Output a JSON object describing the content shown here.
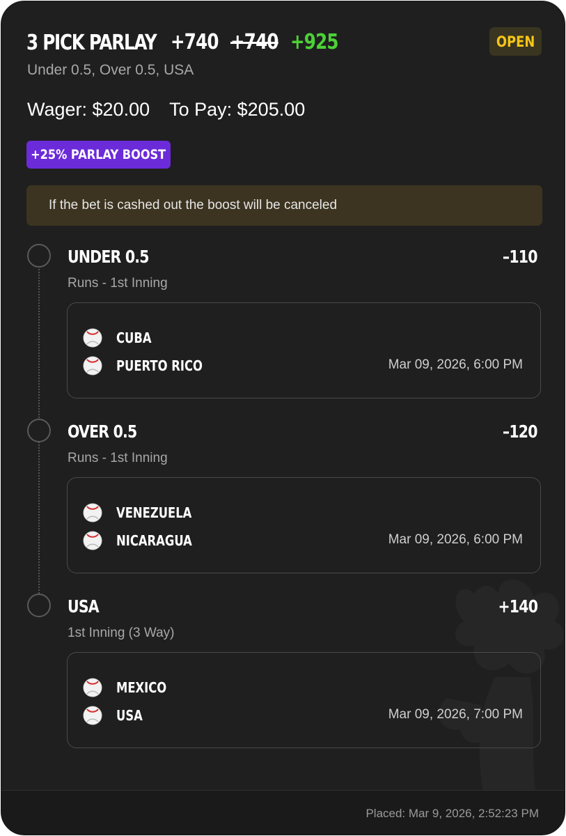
{
  "header": {
    "title": "3 PICK PARLAY",
    "odds_original": "+740",
    "odds_struck": "+740",
    "odds_boosted": "+925",
    "status": "OPEN",
    "subtitle": "Under 0.5, Over 0.5, USA"
  },
  "wager": {
    "wager_text": "Wager: $20.00",
    "to_pay_text": "To Pay: $205.00"
  },
  "boost": {
    "label": "+25% PARLAY BOOST",
    "notice": "If the bet is cashed out the boost will be canceled"
  },
  "legs": [
    {
      "selection": "UNDER 0.5",
      "odds": "–110",
      "market": "Runs - 1st Inning",
      "teams": [
        "CUBA",
        "PUERTO RICO"
      ],
      "time": "Mar 09, 2026, 6:00 PM"
    },
    {
      "selection": "OVER 0.5",
      "odds": "–120",
      "market": "Runs - 1st Inning",
      "teams": [
        "VENEZUELA",
        "NICARAGUA"
      ],
      "time": "Mar 09, 2026, 6:00 PM"
    },
    {
      "selection": "USA",
      "odds": "+140",
      "market": "1st Inning (3 Way)",
      "teams": [
        "MEXICO",
        "USA"
      ],
      "time": "Mar 09, 2026, 7:00 PM"
    }
  ],
  "footer": {
    "placed": "Placed: Mar 9, 2026, 2:52:23 PM"
  },
  "colors": {
    "background": "#1f1f1f",
    "boosted_odds": "#4cd137",
    "open_badge_text": "#f5c518",
    "boost_badge_bg": "#6c2bd9",
    "notice_bg": "#3c3420"
  },
  "icons": {
    "team": "baseball-icon",
    "leg_status": "pending-circle-icon"
  }
}
